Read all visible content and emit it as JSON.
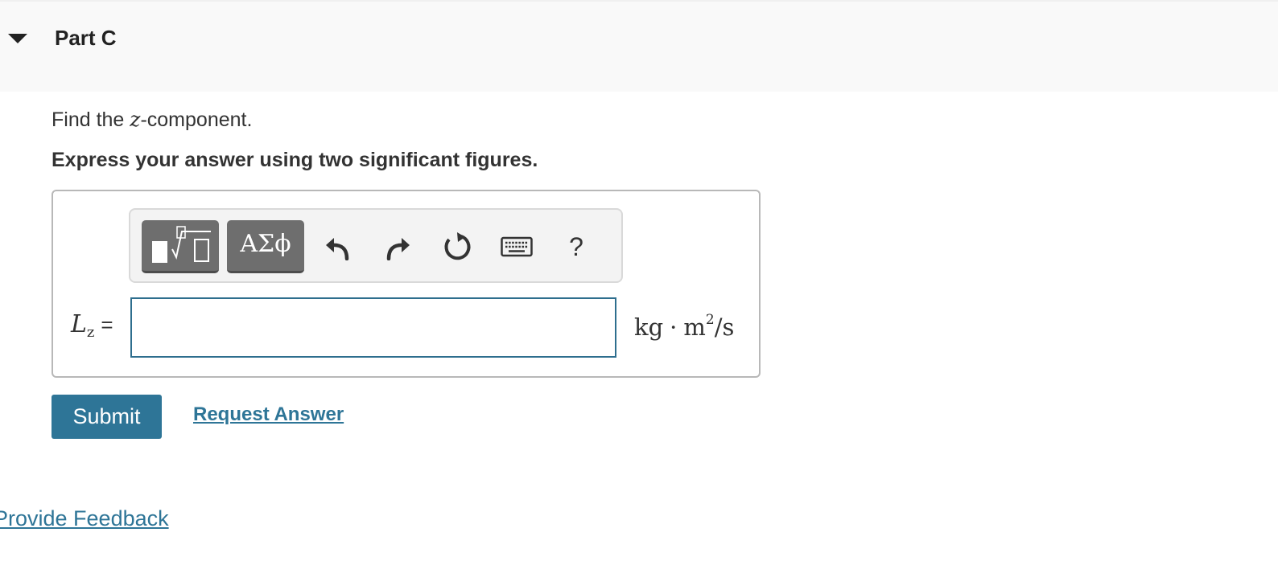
{
  "part": {
    "title": "Part C",
    "caret_icon": "caret-down-icon"
  },
  "prompt": {
    "before": "Find the ",
    "variable": "z",
    "after": "-component."
  },
  "instruction": "Express your answer using two significant figures.",
  "toolbar": {
    "templates_icon": "templates-icon",
    "symbols_label": "ΑΣϕ",
    "undo_icon": "undo-icon",
    "redo_icon": "redo-icon",
    "reset_icon": "reset-icon",
    "keyboard_icon": "keyboard-icon",
    "help_label": "?"
  },
  "answer": {
    "variable": "L",
    "subscript": "z",
    "equals": "=",
    "value": "",
    "units_kg": "kg",
    "units_dot": "·",
    "units_m": "m",
    "units_exp": "2",
    "units_rest": "/s"
  },
  "actions": {
    "submit_label": "Submit",
    "request_label": "Request Answer"
  },
  "footer": {
    "feedback_label": "Provide Feedback"
  },
  "colors": {
    "accent": "#2e7597",
    "input_border": "#2e6e8e",
    "toolbar_button": "#6e6e6e"
  }
}
